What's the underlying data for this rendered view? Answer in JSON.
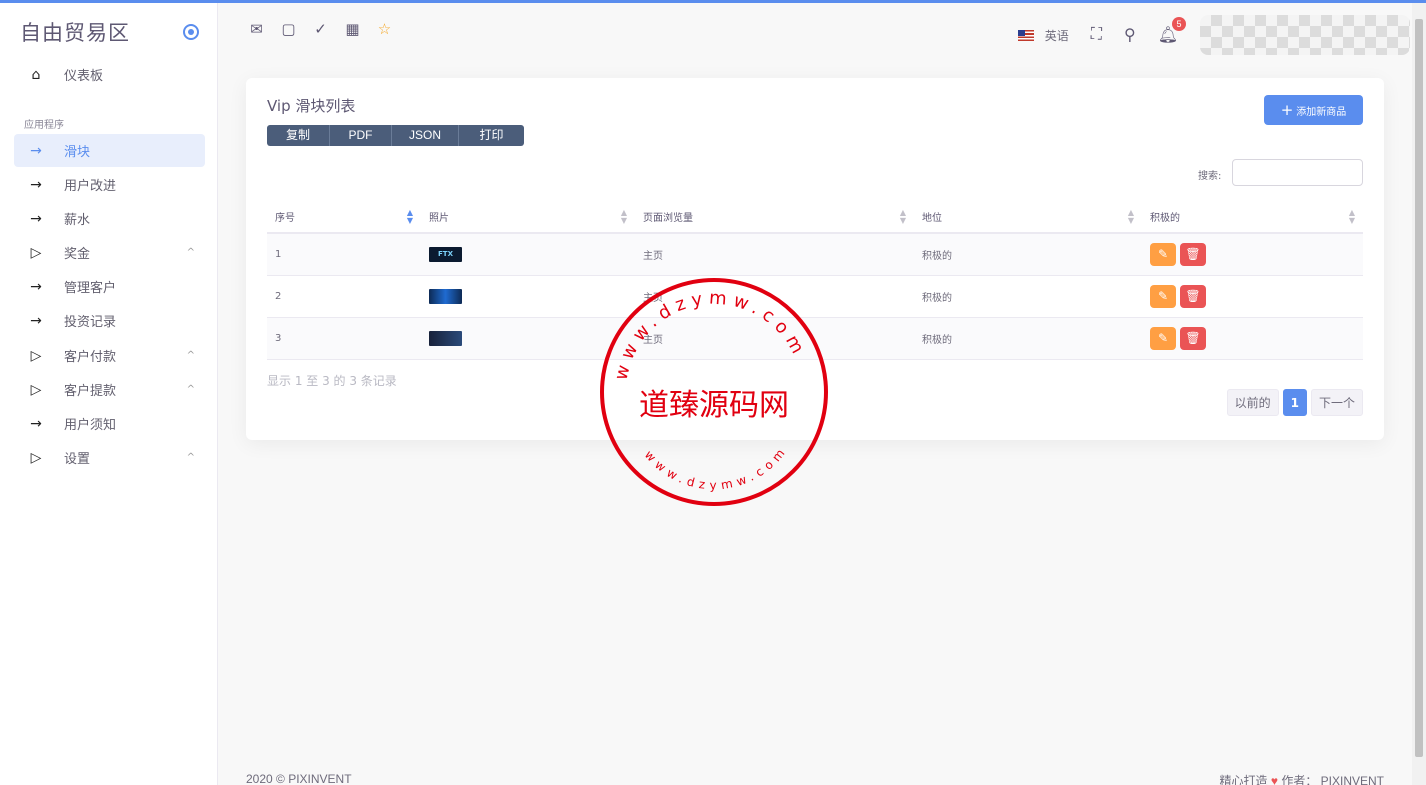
{
  "brand": "自由贸易区",
  "sidebar": {
    "dashboard": "仪表板",
    "section": "应用程序",
    "items": [
      {
        "label": "滑块",
        "icon": "arrow-right-icon",
        "active": true
      },
      {
        "label": "用户改进",
        "icon": "arrow-right-icon"
      },
      {
        "label": "薪水",
        "icon": "arrow-right-icon"
      },
      {
        "label": "奖金",
        "icon": "play-icon",
        "expandable": true
      },
      {
        "label": "管理客户",
        "icon": "arrow-right-icon"
      },
      {
        "label": "投资记录",
        "icon": "arrow-right-icon"
      },
      {
        "label": "客户付款",
        "icon": "play-icon",
        "expandable": true
      },
      {
        "label": "客户提款",
        "icon": "play-icon",
        "expandable": true
      },
      {
        "label": "用户须知",
        "icon": "arrow-right-icon"
      },
      {
        "label": "设置",
        "icon": "play-icon",
        "expandable": true
      }
    ]
  },
  "topbar": {
    "language": "英语",
    "notification_count": "5"
  },
  "card": {
    "title": "Vip 滑块列表",
    "export_buttons": [
      "复制",
      "PDF",
      "JSON",
      "打印"
    ],
    "add_button": "添加新商品",
    "search_label": "搜索:",
    "search_value": "",
    "columns": [
      "序号",
      "照片",
      "页面浏览量",
      "地位",
      "积极的"
    ],
    "rows": [
      {
        "id": "1",
        "thumb": "FTX",
        "page": "主页",
        "status": "积极的"
      },
      {
        "id": "2",
        "thumb": "",
        "page": "主页",
        "status": "积极的"
      },
      {
        "id": "3",
        "thumb": "",
        "page": "主页",
        "status": "积极的"
      }
    ],
    "info": "显示 1 至 3 的 3 条记录",
    "pager": {
      "prev": "以前的",
      "current": "1",
      "next": "下一个"
    }
  },
  "watermark": {
    "center": "道臻源码网",
    "ring": "www.dzymw.com"
  },
  "footer": {
    "left": "2020 © PIXINVENT",
    "right_prefix": "精心打造",
    "right_suffix": "作者：  PIXINVENT"
  },
  "colors": {
    "primary": "#5a8dee",
    "warning": "#ff9f43",
    "danger": "#ea5455",
    "stamp": "#e10010"
  }
}
